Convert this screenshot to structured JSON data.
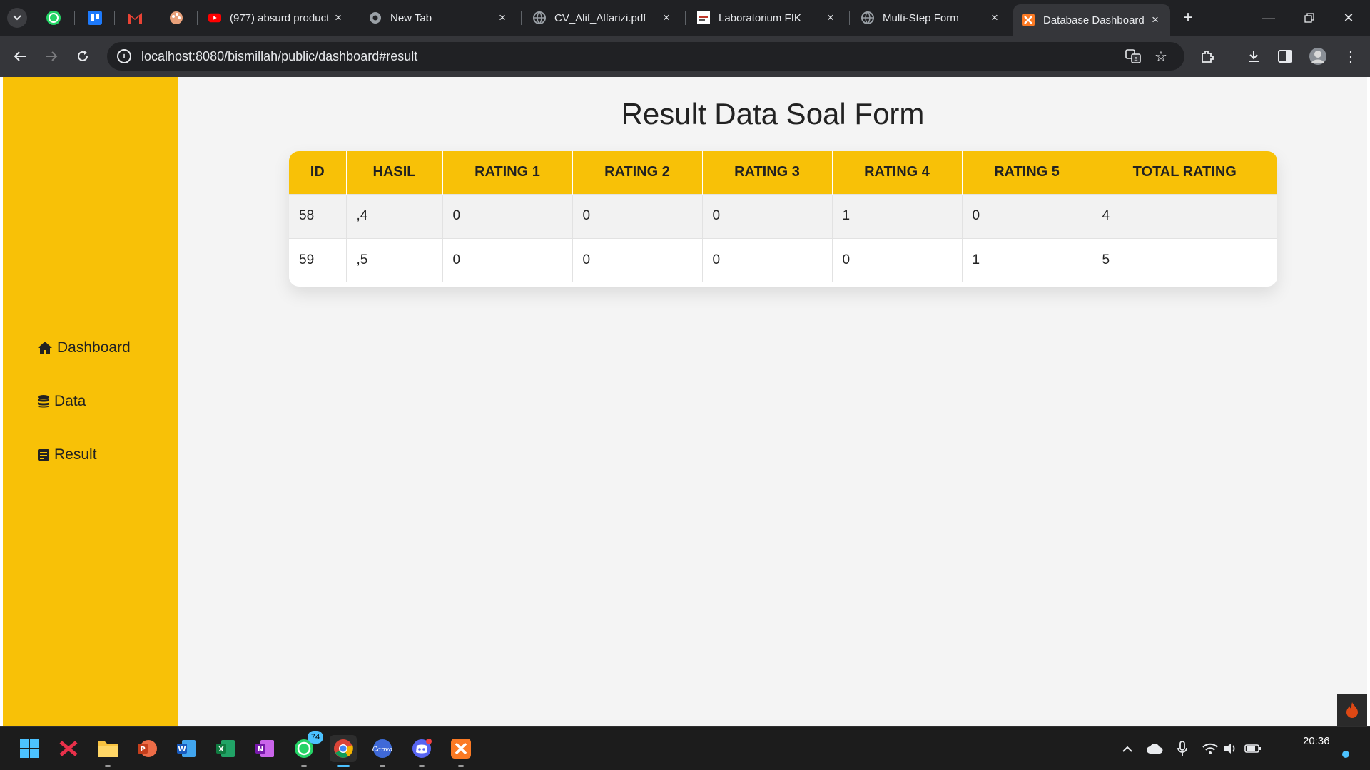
{
  "browser": {
    "tabs": [
      {
        "title": "(977) absurd product"
      },
      {
        "title": "New Tab"
      },
      {
        "title": "CV_Alif_Alfarizi.pdf"
      },
      {
        "title": "Laboratorium FIK"
      },
      {
        "title": "Multi-Step Form"
      },
      {
        "title": "Database Dashboard"
      }
    ],
    "url": "localhost:8080/bismillah/public/dashboard#result"
  },
  "sidebar": {
    "items": [
      {
        "label": "Dashboard",
        "icon": "home-icon"
      },
      {
        "label": "Data",
        "icon": "database-icon"
      },
      {
        "label": "Result",
        "icon": "file-icon"
      }
    ]
  },
  "main": {
    "title": "Result Data Soal Form"
  },
  "table": {
    "headers": [
      "ID",
      "HASIL",
      "RATING 1",
      "RATING 2",
      "RATING 3",
      "RATING 4",
      "RATING 5",
      "TOTAL RATING"
    ],
    "rows": [
      [
        "58",
        ",4",
        "0",
        "0",
        "0",
        "1",
        "0",
        "4"
      ],
      [
        "59",
        ",5",
        "0",
        "0",
        "0",
        "0",
        "1",
        "5"
      ]
    ]
  },
  "taskbar": {
    "whatsapp_badge": "74",
    "clock": "20:36"
  },
  "colors": {
    "accent": "#f8c107",
    "page_bg": "#f4f4f4",
    "taskbar_bg": "#1c1c1c"
  }
}
